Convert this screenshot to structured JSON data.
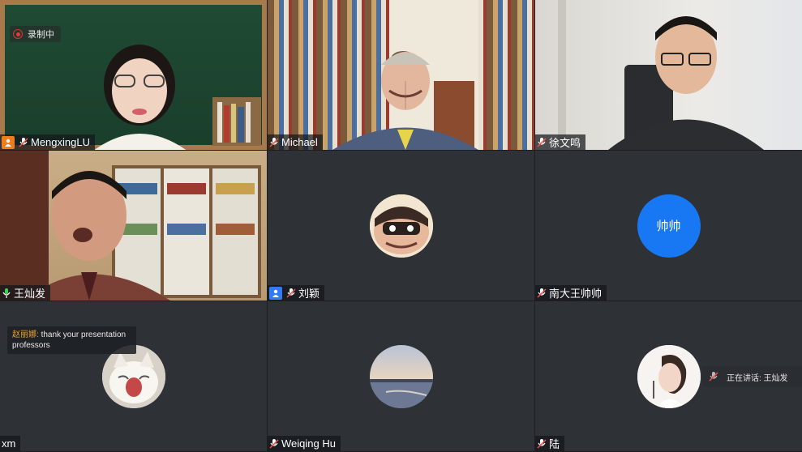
{
  "recording": {
    "label": "录制中"
  },
  "chat": {
    "sender": "赵丽娜:",
    "message": "thank your presentation professors"
  },
  "speaking": {
    "label": "正在讲话: 王灿发"
  },
  "tiles": [
    {
      "name": "MengxingLU"
    },
    {
      "name": "Michael"
    },
    {
      "name": "徐文鸣"
    },
    {
      "name": "王灿发"
    },
    {
      "name": "刘颖"
    },
    {
      "name": "南大王帅帅",
      "avatar_text": "帅帅"
    },
    {
      "name": "xm"
    },
    {
      "name": "Weiqing Hu"
    },
    {
      "name": "陆"
    }
  ],
  "colors": {
    "active_speaker_border": "#2fbf4a",
    "avatar_blue": "#1877f2",
    "host_badge": "#f07d1a",
    "person_badge": "#2f7cf6"
  }
}
